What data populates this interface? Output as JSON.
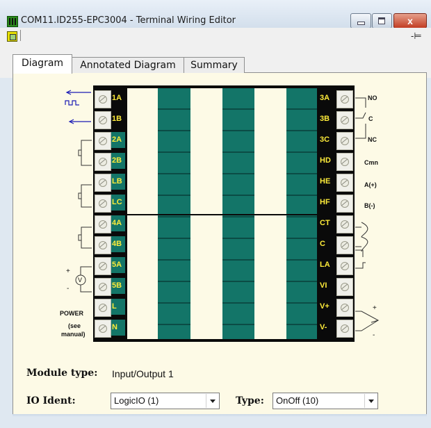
{
  "window": {
    "title": "COM11.ID255-EPC3004 - Terminal Wiring Editor",
    "close_glyph": "x"
  },
  "toolbar": {
    "icon": "module-icon",
    "pin_glyph": "-⊨"
  },
  "tabs": [
    {
      "label": "Diagram",
      "active": true
    },
    {
      "label": "Annotated Diagram",
      "active": false
    },
    {
      "label": "Summary",
      "active": false
    }
  ],
  "diagram": {
    "left_terminals": [
      "1A",
      "1B",
      "2A",
      "2B",
      "LB",
      "LC",
      "4A",
      "4B",
      "5A",
      "5B",
      "L",
      "N"
    ],
    "right_terminals": [
      "3A",
      "3B",
      "3C",
      "HD",
      "HE",
      "HF",
      "CT",
      "C",
      "LA",
      "VI",
      "V+",
      "V-"
    ],
    "right_labels": {
      "no": "NO",
      "c": "C",
      "nc": "NC",
      "cmn": "Cmn",
      "a": "A(+)",
      "b": "B(-)"
    },
    "left_labels": {
      "power": "POWER",
      "see": "(see",
      "manual": "manual)",
      "v": "V",
      "plus": "+",
      "minus": "-"
    },
    "colors": {
      "teal": "#137568",
      "label": "#ffec3a",
      "panel": "#fdfae6"
    }
  },
  "form": {
    "module_type_label": "Module type:",
    "module_type_value": "Input/Output 1",
    "io_ident_label": "IO Ident:",
    "io_ident_value": "LogicIO (1)",
    "type_label": "Type:",
    "type_value": "OnOff (10)"
  }
}
